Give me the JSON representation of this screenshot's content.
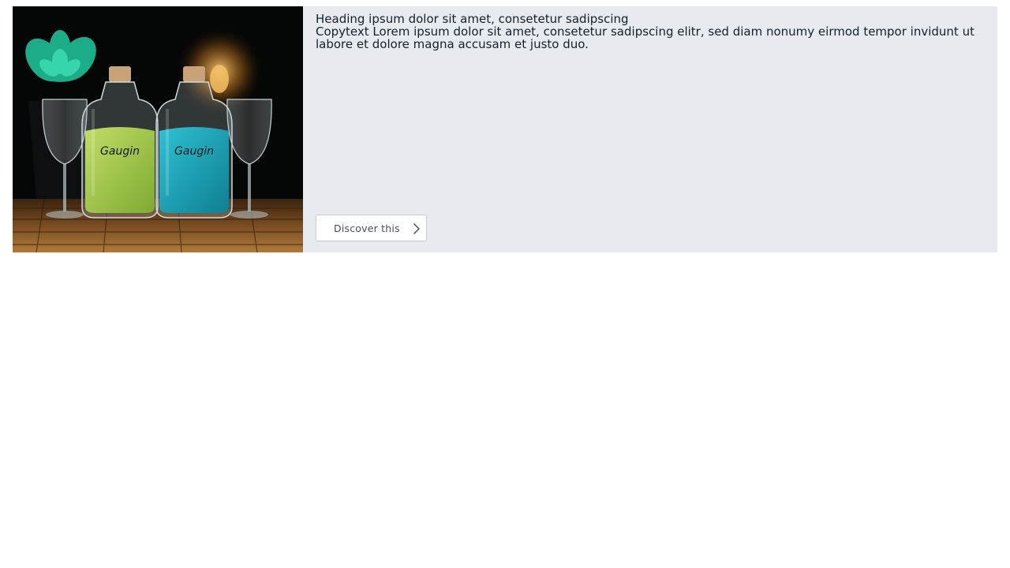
{
  "teaser": {
    "image_alt": "Two Gaugin gin bottles with glasses and a succulent",
    "bottle_left_brand": "Gaugin",
    "bottle_right_brand": "Gaugin",
    "heading": "Heading ipsum dolor sit amet, consetetur sadipscing",
    "copy": "Copytext Lorem ipsum dolor sit amet, consetetur sadipscing elitr, sed diam nonumy eirmod tempor invidunt ut labore et dolore magna accusam et justo duo.",
    "button_label": "Discover this",
    "button_icon": "chevron-right-icon"
  },
  "colors": {
    "panel_background": "#e7ebf0",
    "text": "#15202b",
    "button_border": "#c7cbd1",
    "bottle_left_label": "#9cc44a",
    "bottle_right_label": "#1aa3b5"
  }
}
